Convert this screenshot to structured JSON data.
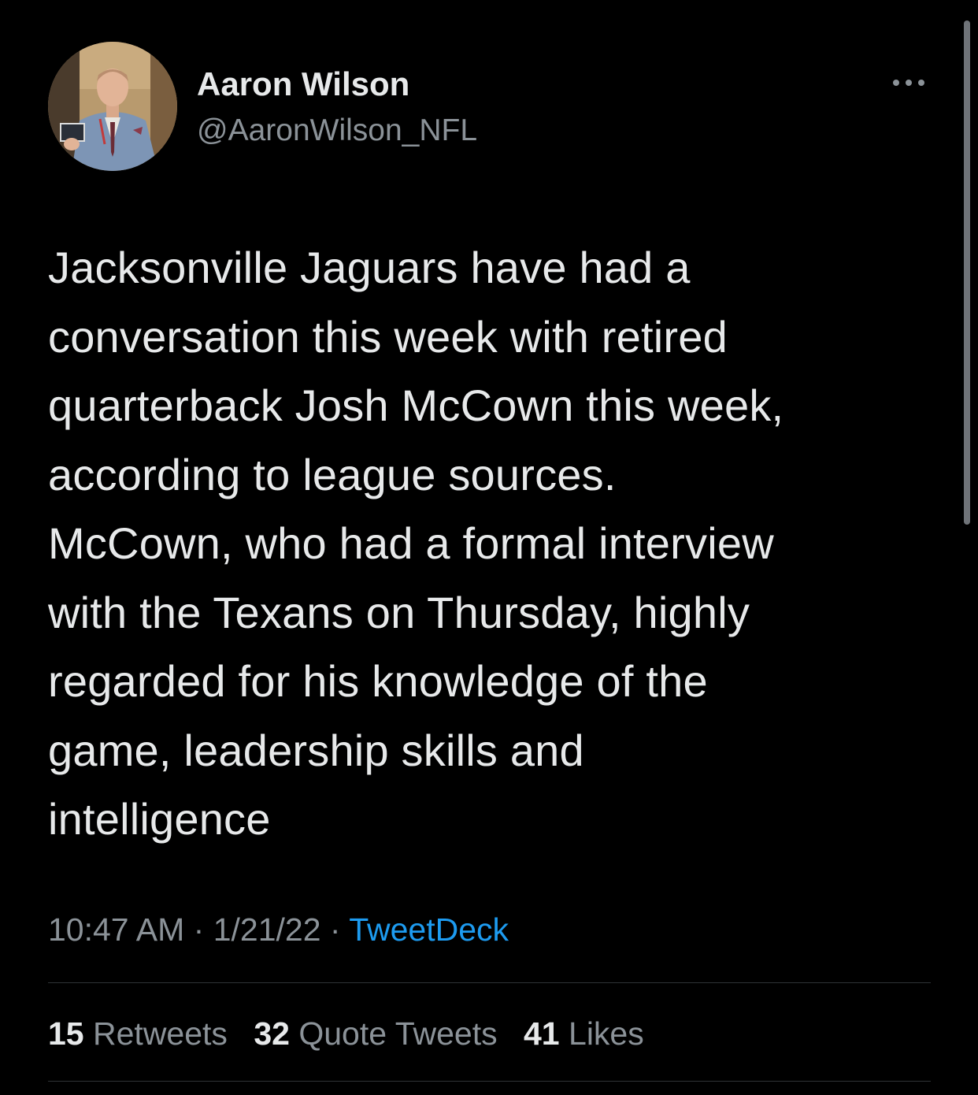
{
  "author": {
    "name": "Aaron Wilson",
    "handle": "@AaronWilson_NFL",
    "avatar_icon": "profile-photo"
  },
  "menu": {
    "icon": "more-dots-icon"
  },
  "tweet": {
    "lines": [
      "Jacksonville Jaguars have had a",
      "conversation this week with retired",
      "quarterback Josh McCown this week,",
      "according to league sources.",
      "McCown, who had a formal interview",
      "with the Texans on Thursday, highly",
      "regarded for his knowledge of the",
      "game, leadership skills and",
      "intelligence"
    ]
  },
  "meta": {
    "time": "10:47 AM",
    "separator": "·",
    "date": "1/21/22",
    "source": "TweetDeck"
  },
  "stats": {
    "retweets_count": "15",
    "retweets_label": "Retweets",
    "quotes_count": "32",
    "quotes_label": "Quote Tweets",
    "likes_count": "41",
    "likes_label": "Likes"
  },
  "colors": {
    "background": "#000000",
    "text": "#e7e9ea",
    "secondary": "#8b9298",
    "link": "#1d9bf0",
    "divider": "#2f3336"
  }
}
